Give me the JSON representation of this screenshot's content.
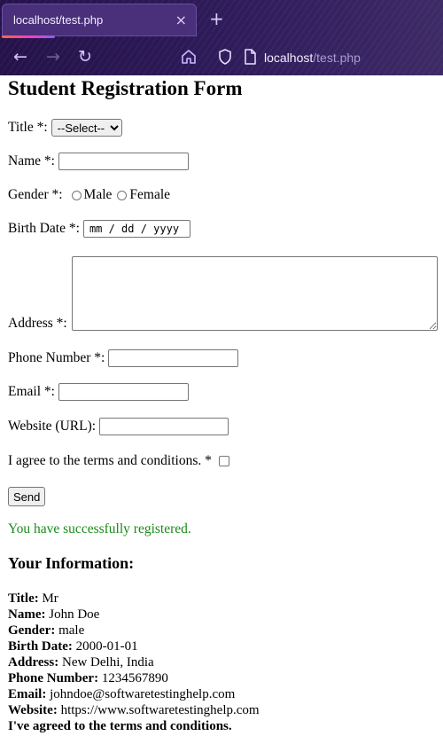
{
  "browser": {
    "tab_title": "localhost/test.php",
    "tab_close": "×",
    "new_tab": "+",
    "url_host": "localhost",
    "url_path": "/test.php",
    "back": "←",
    "forward": "→",
    "reload": "↻"
  },
  "form": {
    "heading": "Student Registration Form",
    "title_label": "Title *:",
    "title_selected": "--Select--",
    "name_label": "Name *:",
    "name_value": "",
    "gender_label": "Gender *:",
    "gender_options": [
      "Male",
      "Female"
    ],
    "birth_label": "Birth Date *:",
    "birth_placeholder": "mm / dd / yyyy",
    "address_label": "Address *:",
    "address_value": "",
    "phone_label": "Phone Number *:",
    "email_label": "Email *:",
    "website_label": "Website (URL):",
    "terms_label": "I agree to the terms and conditions. *",
    "send_label": "Send"
  },
  "result": {
    "success_message": "You have successfully registered.",
    "info_heading": "Your Information:",
    "lines": [
      {
        "label": "Title:",
        "value": "Mr"
      },
      {
        "label": "Name:",
        "value": "John Doe"
      },
      {
        "label": "Gender:",
        "value": "male"
      },
      {
        "label": "Birth Date:",
        "value": "2000-01-01"
      },
      {
        "label": "Address:",
        "value": "New Delhi, India"
      },
      {
        "label": "Phone Number:",
        "value": "1234567890"
      },
      {
        "label": "Email:",
        "value": "johndoe@softwaretestinghelp.com"
      },
      {
        "label": "Website:",
        "value": "https://www.softwaretestinghelp.com"
      }
    ],
    "terms_agreed": "I've agreed to the terms and conditions."
  },
  "colors": {
    "success": "#1a8a1a",
    "chrome_bg": "#2b1856"
  }
}
